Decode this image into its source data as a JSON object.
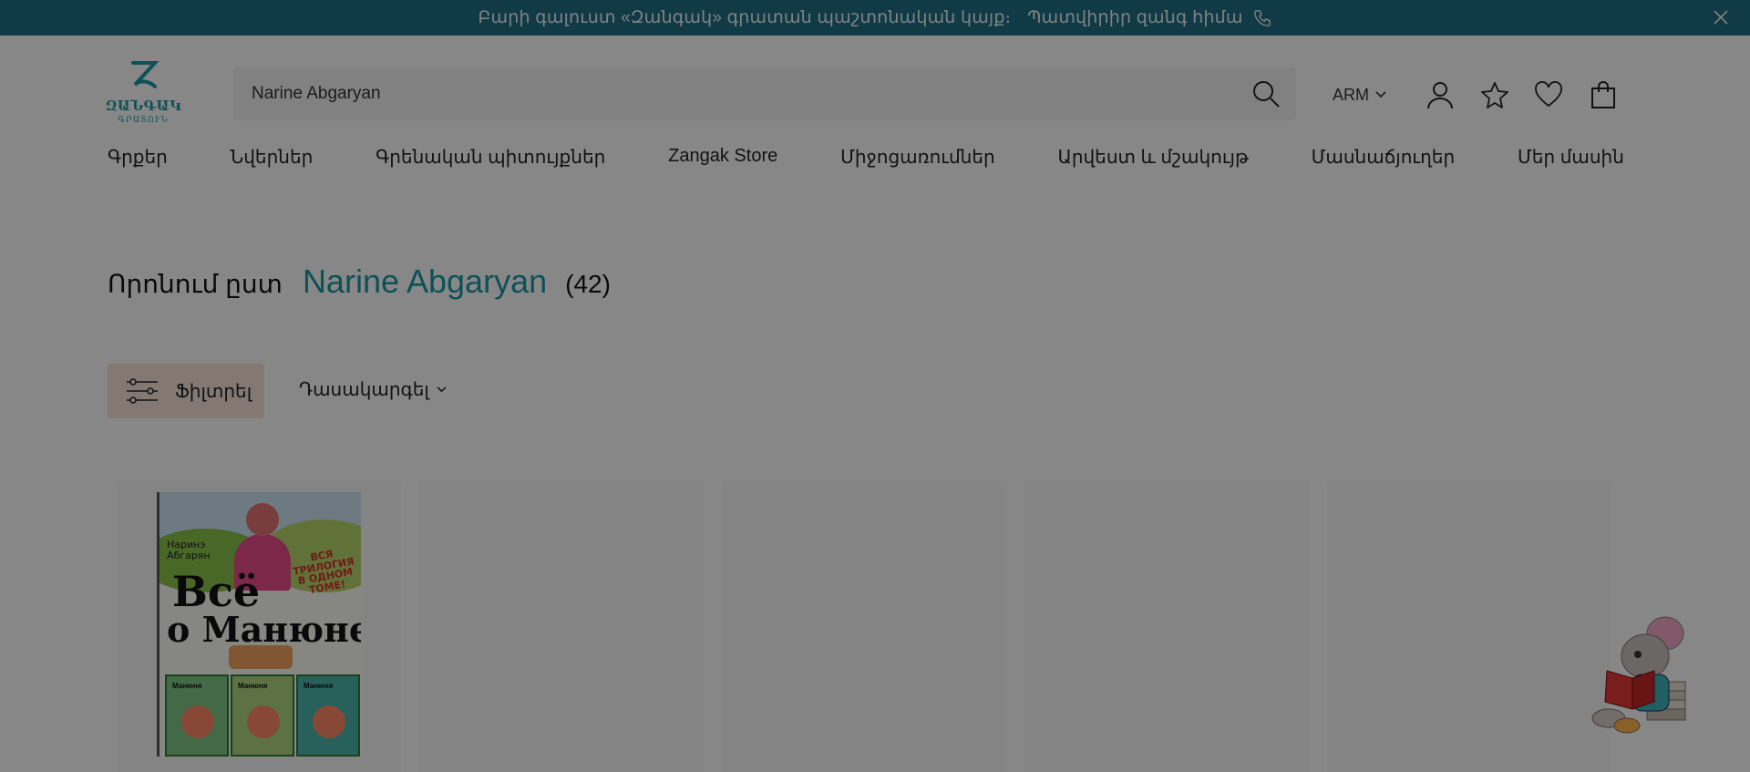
{
  "announcement": {
    "text": "Բարի գալուստ «Զանգակ» գրատան պաշտոնական կայք։",
    "call_label": "Պատվիրիր զանգ հիմա",
    "phone_icon": "phone-icon",
    "close_icon": "close-icon"
  },
  "logo": {
    "name": "ԶԱՆԳԱԿ",
    "sub": "ԳՐԱՏՈՒՆ"
  },
  "search": {
    "value": "Narine Abgaryan",
    "icon": "search-icon"
  },
  "header": {
    "language": "ARM",
    "icons": [
      "user-icon",
      "star-icon",
      "heart-icon",
      "shopping-bag-icon"
    ]
  },
  "nav": {
    "items": [
      {
        "label": "Գրքեր"
      },
      {
        "label": "Նվերներ"
      },
      {
        "label": "Գրենական պիտույքներ"
      },
      {
        "label": "Zangak Store"
      },
      {
        "label": "Միջոցառումներ"
      },
      {
        "label": "Արվեստ և մշակույթ"
      },
      {
        "label": "Մասնաճյուղեր"
      },
      {
        "label": "Մեր մասին"
      }
    ]
  },
  "results": {
    "label": "Որոնում ըստ",
    "query": "Narine Abgaryan",
    "count": "(42)"
  },
  "toolbar": {
    "filter_label": "Ֆիլտրել",
    "filter_icon": "sliders-icon",
    "sort_label": "Դասակարգել"
  },
  "products": [
    {
      "cover_author": "Наринэ\nАбгарян",
      "cover_tag": "ВСЯ ТРИЛОГИЯ В ОДНОМ ТОМЕ!",
      "cover_title_1": "Всё",
      "cover_title_2": "о Манюне",
      "cover_book_label": "Манюня"
    }
  ],
  "colors": {
    "topbar": "#1f6e83",
    "accent": "#1a9aa5",
    "filter_button": "#f7e3d8",
    "overlay": "rgba(0,0,0,0.47)"
  }
}
